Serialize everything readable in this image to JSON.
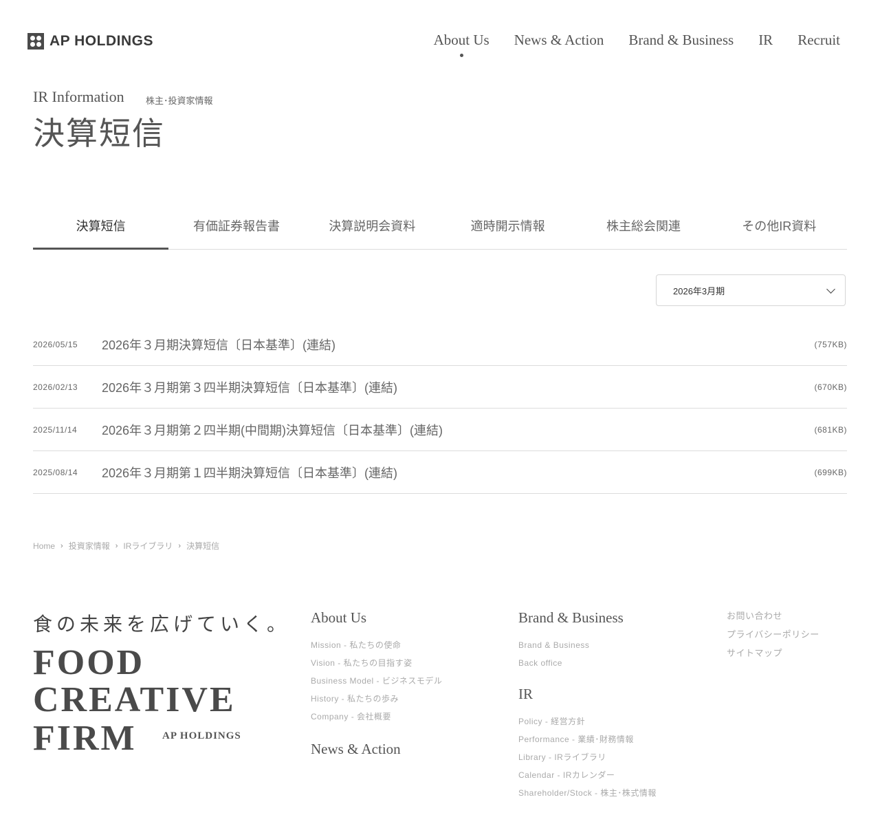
{
  "header": {
    "logo_text": "AP HOLDINGS",
    "nav": [
      {
        "label": "About Us",
        "active": true
      },
      {
        "label": "News & Action"
      },
      {
        "label": "Brand & Business"
      },
      {
        "label": "IR"
      },
      {
        "label": "Recruit"
      }
    ]
  },
  "page_title": {
    "en": "IR Information",
    "ja_sub": "株主･投資家情報",
    "main": "決算短信"
  },
  "tabs": [
    {
      "label": "決算短信",
      "active": true
    },
    {
      "label": "有価証券報告書"
    },
    {
      "label": "決算説明会資料"
    },
    {
      "label": "適時開示情報"
    },
    {
      "label": "株主総会関連"
    },
    {
      "label": "その他IR資料"
    }
  ],
  "period_select": {
    "value": "2026年3月期"
  },
  "documents": [
    {
      "date": "2026/05/15",
      "title": "2026年３月期決算短信〔日本基準〕(連結)",
      "size": "(757KB)"
    },
    {
      "date": "2026/02/13",
      "title": "2026年３月期第３四半期決算短信〔日本基準〕(連結)",
      "size": "(670KB)"
    },
    {
      "date": "2025/11/14",
      "title": "2026年３月期第２四半期(中間期)決算短信〔日本基準〕(連結)",
      "size": "(681KB)"
    },
    {
      "date": "2025/08/14",
      "title": "2026年３月期第１四半期決算短信〔日本基準〕(連結)",
      "size": "(699KB)"
    }
  ],
  "breadcrumb": [
    "Home",
    "投資家情報",
    "IRライブラリ",
    "決算短信"
  ],
  "footer": {
    "tagline": "食の未来を広げていく。",
    "big_lines": [
      "FOOD",
      "CREATIVE",
      "FIRM"
    ],
    "big_sub": "AP HOLDINGS",
    "about_heading": "About Us",
    "about_links": [
      "Mission - 私たちの使命",
      "Vision - 私たちの目指す姿",
      "Business Model - ビジネスモデル",
      "History - 私たちの歩み",
      "Company - 会社概要"
    ],
    "news_heading": "News & Action",
    "brand_heading": "Brand & Business",
    "brand_links": [
      "Brand & Business",
      "Back office"
    ],
    "ir_heading": "IR",
    "ir_links": [
      "Policy - 経営方針",
      "Performance - 業績･財務情報",
      "Library - IRライブラリ",
      "Calendar - IRカレンダー",
      "Shareholder/Stock - 株主･株式情報"
    ],
    "misc_links": [
      "お問い合わせ",
      "プライバシーポリシー",
      "サイトマップ"
    ]
  }
}
